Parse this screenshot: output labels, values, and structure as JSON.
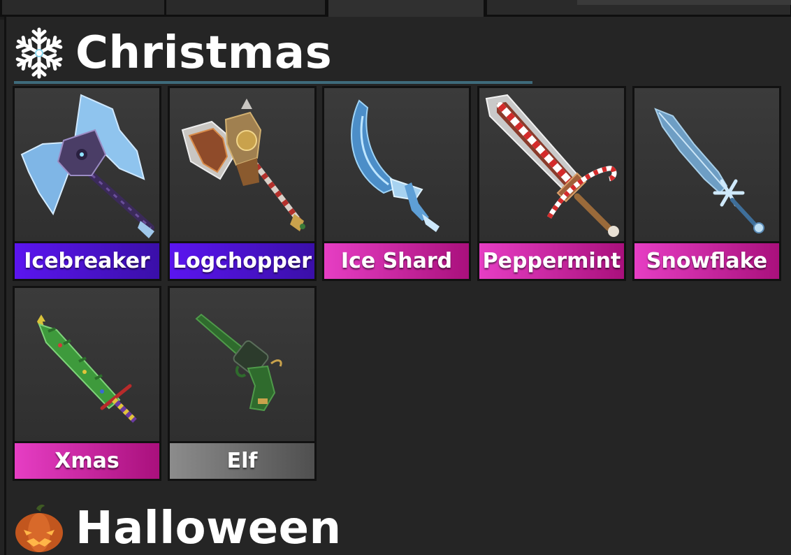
{
  "sections": [
    {
      "title": "Christmas",
      "icon": "snowflake-icon",
      "items": [
        {
          "name": "Icebreaker",
          "rarity": "legendary",
          "icon": "ice-axe-icon"
        },
        {
          "name": "Logchopper",
          "rarity": "legendary",
          "icon": "wood-axe-icon"
        },
        {
          "name": "Ice Shard",
          "rarity": "godly",
          "icon": "ice-scimitar-icon"
        },
        {
          "name": "Peppermint",
          "rarity": "godly",
          "icon": "candy-cane-sword-icon"
        },
        {
          "name": "Snowflake",
          "rarity": "godly",
          "icon": "ice-sword-icon"
        },
        {
          "name": "Xmas",
          "rarity": "godly",
          "icon": "tree-sword-icon"
        },
        {
          "name": "Elf",
          "rarity": "common",
          "icon": "green-revolver-icon"
        }
      ]
    },
    {
      "title": "Halloween",
      "icon": "pumpkin-icon"
    }
  ],
  "colors": {
    "legendary": "#5b15f0",
    "godly": "#e63ec4",
    "common": "#8c8c8c",
    "underline": "#3e6b7b"
  }
}
